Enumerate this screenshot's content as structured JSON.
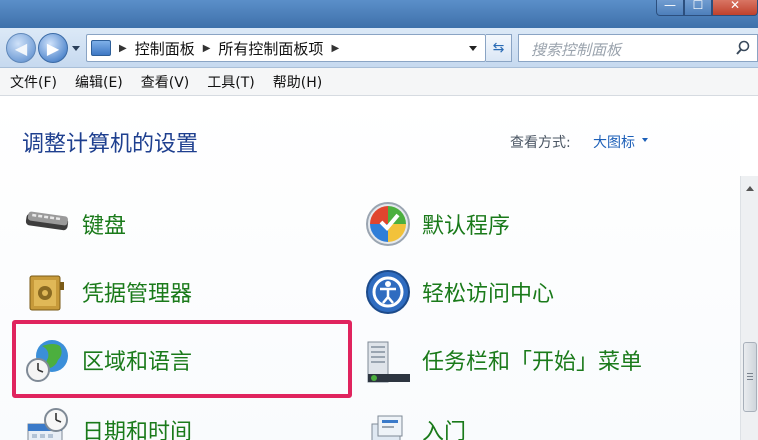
{
  "window": {
    "controls": {
      "minimize": "—",
      "maximize": "☐",
      "close": "✕"
    }
  },
  "nav": {
    "back_icon": "back-arrow-icon",
    "forward_icon": "forward-arrow-icon",
    "breadcrumbs": [
      "控制面板",
      "所有控制面板项"
    ],
    "search_placeholder": "搜索控制面板"
  },
  "menu": {
    "items": [
      "文件(F)",
      "编辑(E)",
      "查看(V)",
      "工具(T)",
      "帮助(H)"
    ]
  },
  "content": {
    "title": "调整计算机的设置",
    "view_label": "查看方式:",
    "view_value": "大图标",
    "items": [
      {
        "label": "键盘",
        "icon": "keyboard-icon"
      },
      {
        "label": "默认程序",
        "icon": "default-programs-icon"
      },
      {
        "label": "凭据管理器",
        "icon": "credential-manager-icon"
      },
      {
        "label": "轻松访问中心",
        "icon": "ease-of-access-icon"
      },
      {
        "label": "区域和语言",
        "icon": "region-language-icon"
      },
      {
        "label": "任务栏和「开始」菜单",
        "icon": "taskbar-start-menu-icon"
      },
      {
        "label": "日期和时间",
        "icon": "date-time-icon"
      },
      {
        "label": "入门",
        "icon": "getting-started-icon"
      }
    ],
    "highlighted_item": "区域和语言"
  },
  "colors": {
    "item_label": "#1a7a1a",
    "title": "#1e3f8f",
    "highlight_border": "#e0245e"
  }
}
